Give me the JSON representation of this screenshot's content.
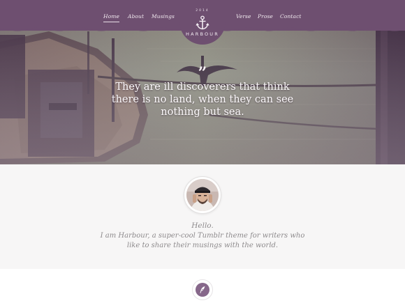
{
  "nav": {
    "left": [
      {
        "label": "Home",
        "active": true
      },
      {
        "label": "About",
        "active": false
      },
      {
        "label": "Musings",
        "active": false
      }
    ],
    "right": [
      {
        "label": "Verse",
        "active": false
      },
      {
        "label": "Prose",
        "active": false
      },
      {
        "label": "Contact",
        "active": false
      }
    ]
  },
  "brand": {
    "year": "2014",
    "name": "HARBOUR",
    "icon": "anchor-icon"
  },
  "hero": {
    "quote_mark": "”",
    "quote": "They are ill discoverers that think there is no land, when they can see nothing but sea."
  },
  "bio": {
    "greeting": "Hello.",
    "text": "I am Harbour, a super-cool Tumblr theme for writers who like to share their musings with the world."
  },
  "post": {
    "icon": "quill-icon"
  },
  "colors": {
    "accent": "#6e4f70",
    "bio_background": "#f7f6f6",
    "text_muted": "#8d8a8c"
  }
}
